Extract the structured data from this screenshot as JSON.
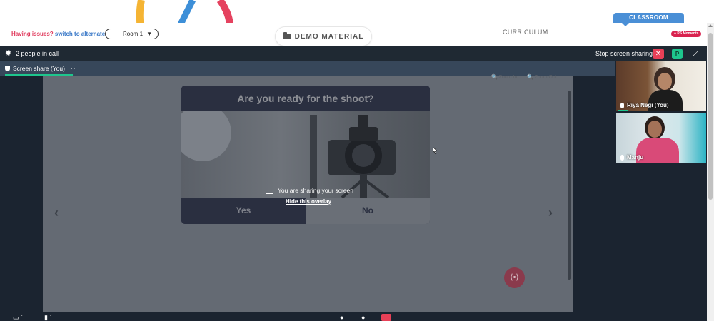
{
  "top": {
    "issues_text": "Having issues?",
    "alternate_link": "switch to alternate room",
    "room_select_value": "Room 1",
    "demo_material_label": "DEMO MATERIAL",
    "curriculum_label": "CURRICULUM",
    "classroom_tab_label": "CLASSROOM",
    "moments_label": "PS Moments"
  },
  "call": {
    "people_count_label": "2 people in call",
    "stop_sharing_label": "Stop screen sharing",
    "stop_icon": "✕",
    "profile_badge": "P",
    "expand_icon": "⤢",
    "screen_share_tab_label": "Screen share (You)",
    "tab_more": "···"
  },
  "shared_screen": {
    "zoom_in_label": "Zoom In",
    "zoom_out_label": "Zoom Out",
    "quiz_title": "Are you ready for the shoot?",
    "option_yes": "Yes",
    "option_no": "No",
    "prev_arrow": "‹",
    "next_arrow": "›",
    "sharing_message": "You are sharing your screen",
    "hide_overlay_link": "Hide this overlay"
  },
  "participants": [
    {
      "name": "Riya Negi (You)"
    },
    {
      "name": "Manju"
    }
  ],
  "colors": {
    "accent_green": "#1ec68d",
    "stop_red": "#e84057",
    "classroom_blue": "#4a8fd6",
    "issues_red": "#e0375a"
  }
}
